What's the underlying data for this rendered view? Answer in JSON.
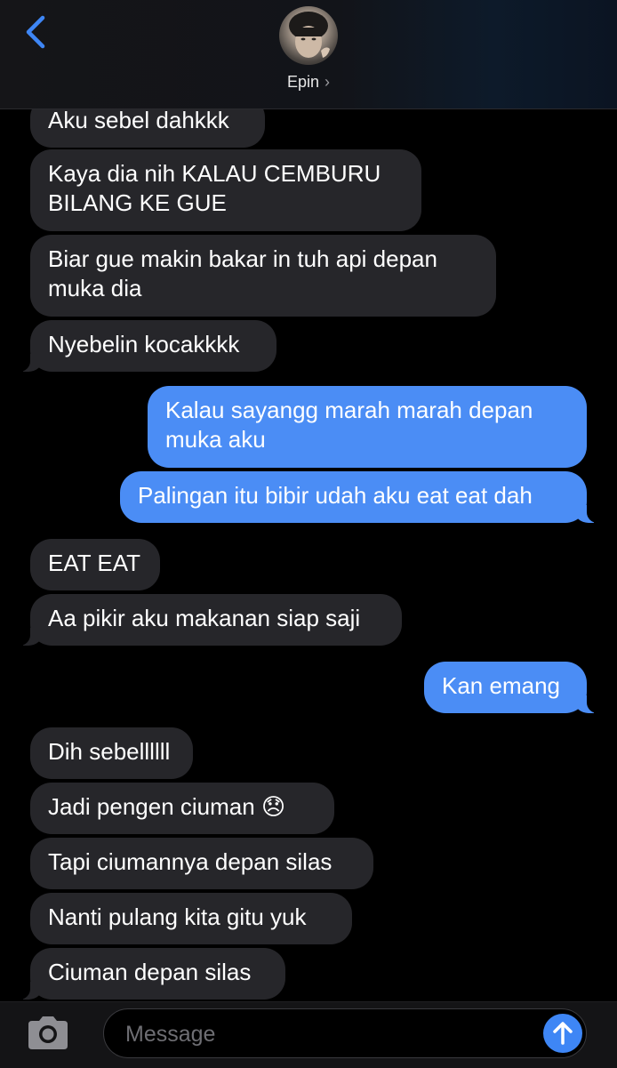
{
  "header": {
    "contact_name": "Epin",
    "chevron": "›"
  },
  "messages": [
    {
      "dir": "in",
      "text": "Aku sebel dahkkk"
    },
    {
      "dir": "in",
      "text": "Kaya dia nih KALAU CEMBURU\nBILANG KE GUE"
    },
    {
      "dir": "in",
      "text": "Biar gue makin bakar in tuh api depan\nmuka dia"
    },
    {
      "dir": "in",
      "text": "Nyebelin kocakkkk"
    },
    {
      "dir": "out",
      "text": "Kalau sayangg marah marah depan\nmuka aku"
    },
    {
      "dir": "out",
      "text": "Palingan itu bibir udah aku eat eat dah"
    },
    {
      "dir": "in",
      "text": "EAT EAT"
    },
    {
      "dir": "in",
      "text": "Aa pikir aku makanan siap saji"
    },
    {
      "dir": "out",
      "text": "Kan emang"
    },
    {
      "dir": "in",
      "text": "Dih sebellllll"
    },
    {
      "dir": "in",
      "text": "Jadi pengen ciuman 😞"
    },
    {
      "dir": "in",
      "text": "Tapi ciumannya depan silas"
    },
    {
      "dir": "in",
      "text": "Nanti pulang kita gitu yuk"
    },
    {
      "dir": "in",
      "text": "Ciuman depan silas"
    }
  ],
  "composer": {
    "placeholder": "Message",
    "camera_icon": "camera-icon",
    "send_icon": "arrow-up-icon"
  },
  "colors": {
    "incoming_bubble": "#26262a",
    "outgoing_bubble": "#4b8df5",
    "accent": "#3e86f5"
  }
}
